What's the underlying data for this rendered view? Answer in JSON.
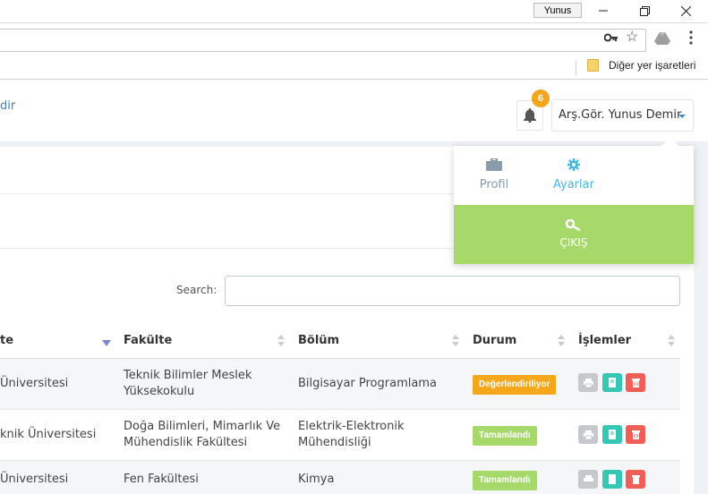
{
  "window": {
    "user_name": "Yunus",
    "minimize_icon": "minimize-icon",
    "restore_icon": "restore-icon",
    "close_icon": "close-icon"
  },
  "bookmarks": {
    "folder_label": "Diğer yer işaretleri"
  },
  "header": {
    "breadcrumb_fragment": "dir",
    "notification_count": "6",
    "user_label": "Arş.Gör. Yunus Demir"
  },
  "user_menu": {
    "profile_label": "Profil",
    "settings_label": "Ayarlar",
    "logout_label": "ÇIKIŞ"
  },
  "search": {
    "label": "Search:",
    "value": ""
  },
  "table": {
    "columns": [
      "te",
      "Fakülte",
      "Bölüm",
      "Durum",
      "İşlemler"
    ],
    "rows": [
      {
        "university": "Üniversitesi",
        "faculty": "Teknik Bilimler Meslek Yüksekokulu",
        "department": "Bilgisayar Programlama",
        "status": "Değerlendiriliyor"
      },
      {
        "university": "knik Üniversitesi",
        "faculty": "Doğa Bilimleri, Mimarlık Ve Mühendislik Fakültesi",
        "department": "Elektrik-Elektronik Mühendisliği",
        "status": "Tamamlandı"
      },
      {
        "university": "Üniversitesi",
        "faculty": "Fen Fakültesi",
        "department": "Kimya",
        "status": "Tamamlandı"
      }
    ]
  },
  "colors": {
    "status_review": "#f5a71c",
    "status_done": "#a6d96a",
    "print_btn": "#c5c9ce",
    "view_btn": "#36c6b4",
    "delete_btn": "#ef5f57",
    "accent_link": "#3c8dbc"
  }
}
